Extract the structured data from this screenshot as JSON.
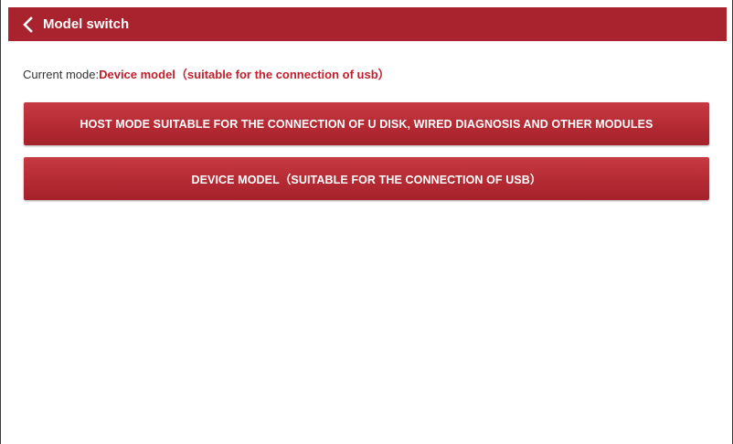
{
  "header": {
    "title": "Model switch",
    "back_icon": "chevron-left-icon"
  },
  "status": {
    "prefix": "Current mode:",
    "value": "Device model（suitable for the connection of usb）"
  },
  "buttons": {
    "host_mode": "HOST MODE SUITABLE FOR THE CONNECTION OF U DISK, WIRED DIAGNOSIS AND OTHER MODULES",
    "device_mode": "DEVICE MODEL（SUITABLE FOR THE CONNECTION OF USB）"
  },
  "colors": {
    "accent": "#a8232d",
    "status_value": "#c0202c",
    "button": "#b42a33"
  }
}
